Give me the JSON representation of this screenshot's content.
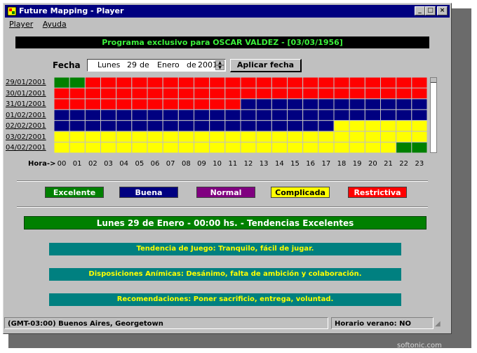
{
  "window": {
    "title": "Future Mapping - Player",
    "controls": {
      "minimize": "_",
      "maximize": "□",
      "close": "×"
    }
  },
  "menu": [
    "Player",
    "Ayuda"
  ],
  "program_text": "Programa exclusivo para OSCAR VALDEZ - [03/03/1956]",
  "date_picker": {
    "label": "Fecha",
    "weekday": "Lunes",
    "day": "29",
    "de1": "de",
    "month": "Enero",
    "de2": "de",
    "year": "2001",
    "apply_button": "Aplicar fecha"
  },
  "colors": {
    "G": "#008000",
    "R": "#ff0000",
    "B": "#000080",
    "Y": "#ffff00",
    "P": "#800080"
  },
  "grid": {
    "dates": [
      "29/01/2001",
      "30/01/2001",
      "31/01/2001",
      "01/02/2001",
      "02/02/2001",
      "03/02/2001",
      "04/02/2001"
    ],
    "hours_label": "Hora->",
    "hours": [
      "00",
      "01",
      "02",
      "03",
      "04",
      "05",
      "06",
      "07",
      "08",
      "09",
      "10",
      "11",
      "12",
      "13",
      "14",
      "15",
      "16",
      "17",
      "18",
      "19",
      "20",
      "21",
      "22",
      "23"
    ],
    "rows": [
      [
        "G",
        "G",
        "R",
        "R",
        "R",
        "R",
        "R",
        "R",
        "R",
        "R",
        "R",
        "R",
        "R",
        "R",
        "R",
        "R",
        "R",
        "R",
        "R",
        "R",
        "R",
        "R",
        "R",
        "R"
      ],
      [
        "R",
        "R",
        "R",
        "R",
        "R",
        "R",
        "R",
        "R",
        "R",
        "R",
        "R",
        "R",
        "R",
        "R",
        "R",
        "R",
        "R",
        "R",
        "R",
        "R",
        "R",
        "R",
        "R",
        "R"
      ],
      [
        "R",
        "R",
        "R",
        "R",
        "R",
        "R",
        "R",
        "R",
        "R",
        "R",
        "R",
        "R",
        "B",
        "B",
        "B",
        "B",
        "B",
        "B",
        "B",
        "B",
        "B",
        "B",
        "B",
        "B"
      ],
      [
        "B",
        "B",
        "B",
        "B",
        "B",
        "B",
        "B",
        "B",
        "B",
        "B",
        "B",
        "B",
        "B",
        "B",
        "B",
        "B",
        "B",
        "B",
        "B",
        "B",
        "B",
        "B",
        "B",
        "B"
      ],
      [
        "B",
        "B",
        "B",
        "B",
        "B",
        "B",
        "B",
        "B",
        "B",
        "B",
        "B",
        "B",
        "B",
        "B",
        "B",
        "B",
        "B",
        "B",
        "Y",
        "Y",
        "Y",
        "Y",
        "Y",
        "Y"
      ],
      [
        "Y",
        "Y",
        "Y",
        "Y",
        "Y",
        "Y",
        "Y",
        "Y",
        "Y",
        "Y",
        "Y",
        "Y",
        "Y",
        "Y",
        "Y",
        "Y",
        "Y",
        "Y",
        "Y",
        "Y",
        "Y",
        "Y",
        "Y",
        "Y"
      ],
      [
        "Y",
        "Y",
        "Y",
        "Y",
        "Y",
        "Y",
        "Y",
        "Y",
        "Y",
        "Y",
        "Y",
        "Y",
        "Y",
        "Y",
        "Y",
        "Y",
        "Y",
        "Y",
        "Y",
        "Y",
        "Y",
        "Y",
        "G",
        "G"
      ]
    ]
  },
  "legend": [
    {
      "label": "Excelente",
      "bg": "#008000",
      "fg": "#ffffff"
    },
    {
      "label": "Buena",
      "bg": "#000080",
      "fg": "#ffffff"
    },
    {
      "label": "Normal",
      "bg": "#800080",
      "fg": "#ffffff"
    },
    {
      "label": "Complicada",
      "bg": "#ffff00",
      "fg": "#000000"
    },
    {
      "label": "Restrictiva",
      "bg": "#ff0000",
      "fg": "#ffffff"
    }
  ],
  "main_text": "Lunes 29 de Enero - 00:00 hs. - Tendencias Excelentes",
  "details": [
    "Tendencia de Juego: Tranquilo, fácil de jugar.",
    "Disposiciones Anímicas: Desánimo, falta de ambición y colaboración.",
    "Recomendaciones: Poner sacrificio, entrega, voluntad."
  ],
  "status": {
    "timezone": "(GMT-03:00) Buenos Aires, Georgetown",
    "dst": "Horario verano: NO"
  },
  "watermark": "softonic.com"
}
